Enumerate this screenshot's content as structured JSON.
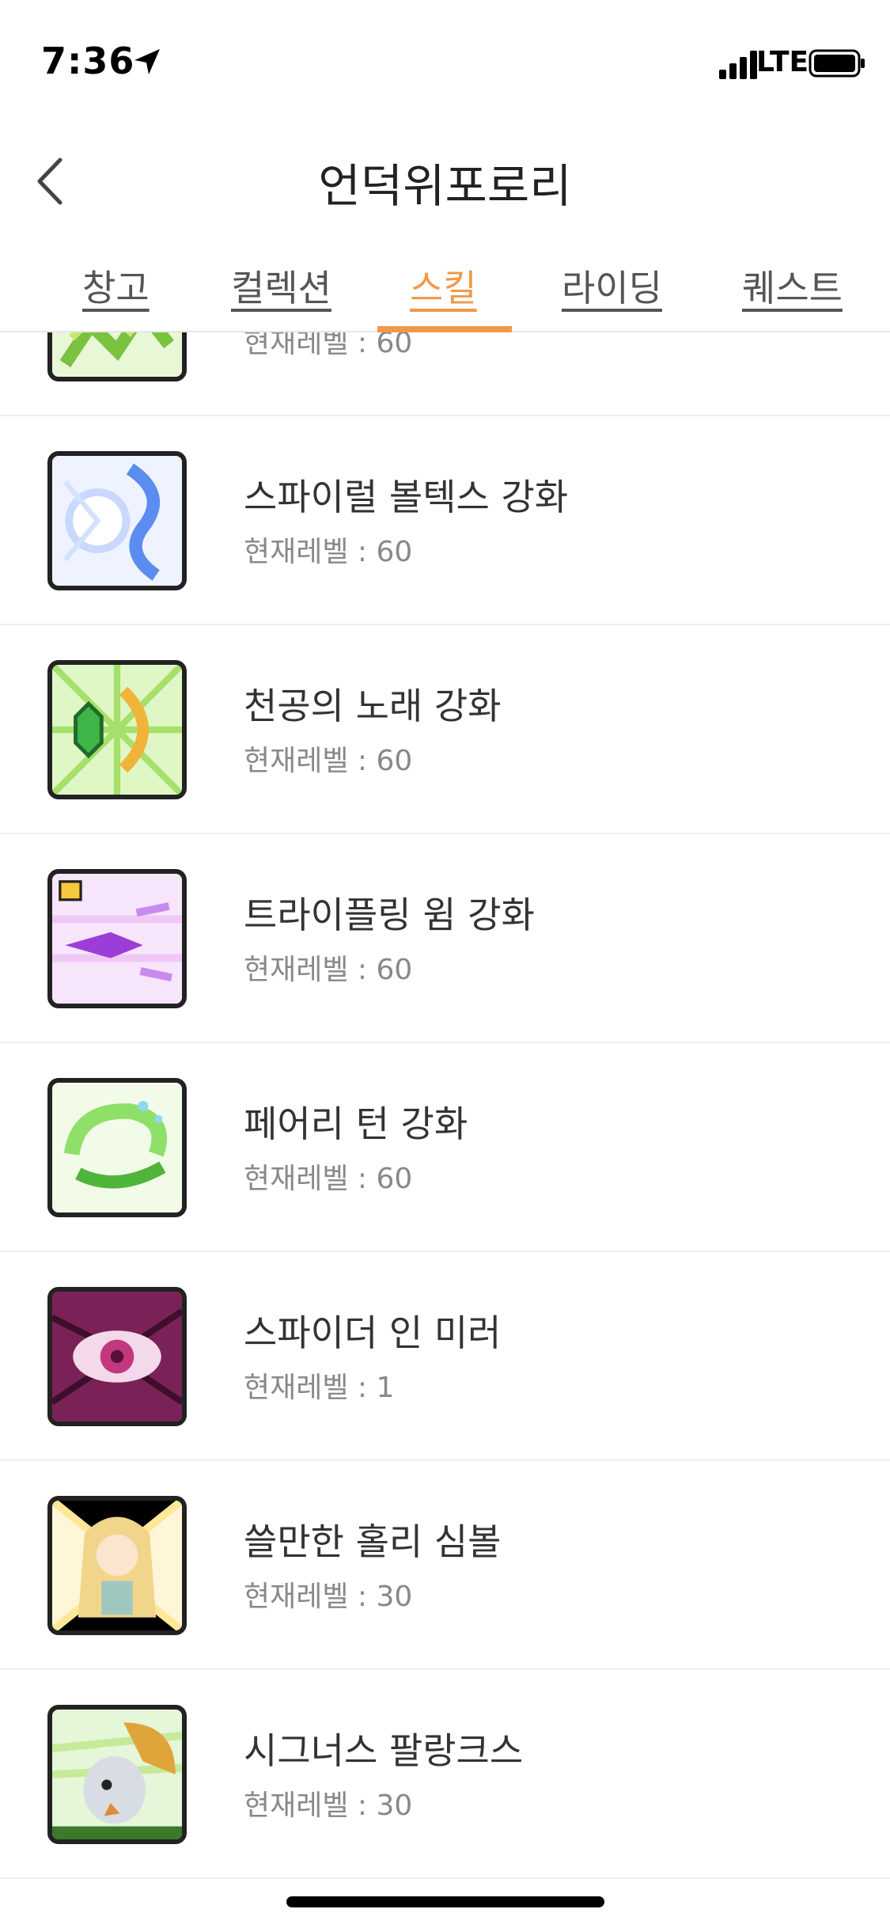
{
  "status_bar": {
    "time": "7:36",
    "network": "LTE"
  },
  "header": {
    "title": "언덕위포로리"
  },
  "tabs": [
    {
      "label": "창고",
      "active": false
    },
    {
      "label": "컬렉션",
      "active": false
    },
    {
      "label": "스킬",
      "active": true
    },
    {
      "label": "라이딩",
      "active": false
    },
    {
      "label": "퀘스트",
      "active": false
    }
  ],
  "colors": {
    "accent": "#ef9a4a"
  },
  "skills": [
    {
      "name": "",
      "level": "현재레벨 : 60",
      "icon": "green-leaf-skill-icon"
    },
    {
      "name": "스파이럴 볼텍스 강화",
      "level": "현재레벨 : 60",
      "icon": "spiral-vortex-icon"
    },
    {
      "name": "천공의 노래 강화",
      "level": "현재레벨 : 60",
      "icon": "sky-song-icon"
    },
    {
      "name": "트라이플링 윔 강화",
      "level": "현재레벨 : 60",
      "icon": "trifling-whim-icon"
    },
    {
      "name": "페어리 턴 강화",
      "level": "현재레벨 : 60",
      "icon": "fairy-turn-icon"
    },
    {
      "name": "스파이더 인 미러",
      "level": "현재레벨 : 1",
      "icon": "spider-in-mirror-icon"
    },
    {
      "name": "쓸만한 홀리 심볼",
      "level": "현재레벨 : 30",
      "icon": "holy-symbol-icon"
    },
    {
      "name": "시그너스 팔랑크스",
      "level": "현재레벨 : 30",
      "icon": "cygnus-phalanx-icon"
    }
  ]
}
